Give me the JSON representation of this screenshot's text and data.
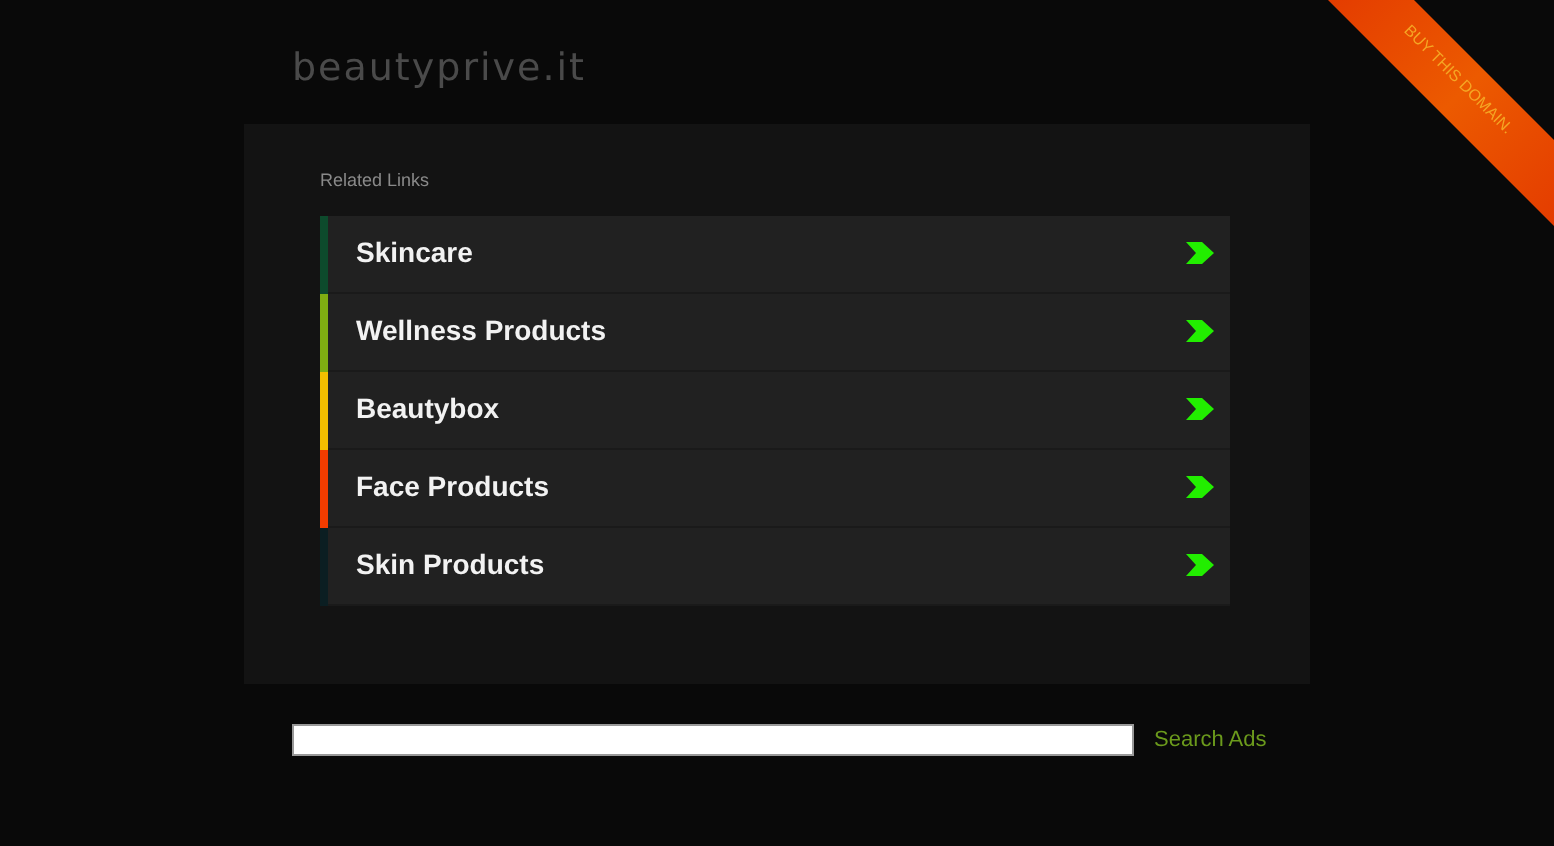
{
  "site_title": "beautyprive.it",
  "ribbon": "BUY THIS DOMAIN.",
  "related_heading": "Related Links",
  "links": [
    {
      "label": "Skincare",
      "color": "#0d4a2c"
    },
    {
      "label": "Wellness Products",
      "color": "#7fae12"
    },
    {
      "label": "Beautybox",
      "color": "#f2be00"
    },
    {
      "label": "Face Products",
      "color": "#f23c00"
    },
    {
      "label": "Skin Products",
      "color": "#0b1e22"
    }
  ],
  "search": {
    "button": "Search Ads"
  }
}
